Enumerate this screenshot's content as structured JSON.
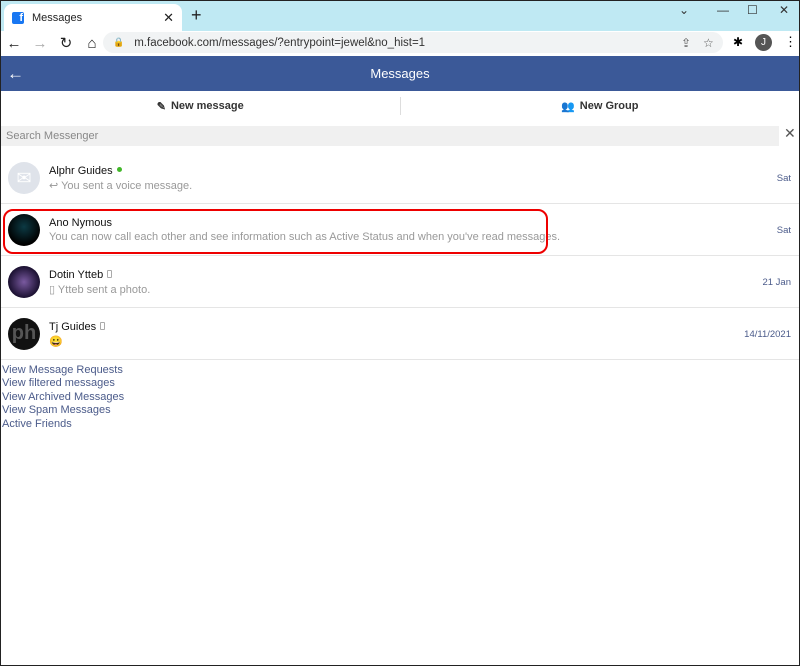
{
  "browser": {
    "tab_title": "Messages",
    "url": "m.facebook.com/messages/?entrypoint=jewel&no_hist=1",
    "profile_initial": "J"
  },
  "header": {
    "title": "Messages"
  },
  "actions": {
    "new_message": "New message",
    "new_group": "New Group"
  },
  "search": {
    "placeholder": "Search Messenger"
  },
  "conversations": [
    {
      "name": "Alphr Guides",
      "snippet": "You sent a voice message.",
      "date": "Sat",
      "online": true
    },
    {
      "name": "Ano Nymous",
      "snippet": "You can now call each other and see information such as Active Status and when you've read messages.",
      "date": "Sat"
    },
    {
      "name": "Dotin Ytteb",
      "snippet": "Ytteb sent a photo.",
      "date": "21 Jan"
    },
    {
      "name": "Tj Guides",
      "snippet": "😀",
      "date": "14/11/2021"
    }
  ],
  "links": [
    "View Message Requests",
    "View filtered messages",
    "View Archived Messages",
    "View Spam Messages",
    "Active Friends"
  ],
  "colors": {
    "brand": "#3b5998",
    "highlight": "#e00000",
    "online": "#42b72a"
  }
}
